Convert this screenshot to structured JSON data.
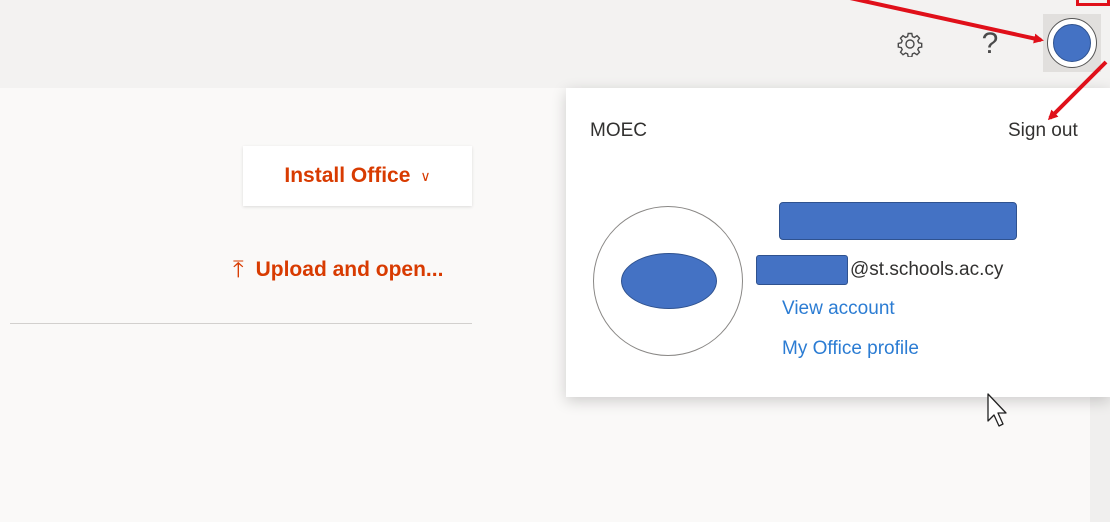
{
  "header": {
    "help_label": "?",
    "icons": [
      "gear-icon",
      "help-icon",
      "avatar-icon"
    ]
  },
  "main": {
    "install_label": "Install Office",
    "install_chevron": "∨",
    "upload_arrow": "⤒",
    "upload_label": "Upload and open..."
  },
  "account_menu": {
    "org_name": "MOEC",
    "sign_out_label": "Sign out",
    "email_domain": "@st.schools.ac.cy",
    "view_account_label": "View account",
    "office_profile_label": "My Office profile"
  },
  "colors": {
    "accent": "#d83b01",
    "link": "#2b7cd3",
    "redaction": "#4472c4",
    "annotation": "#e0101a",
    "header_bg": "#f3f2f1"
  }
}
